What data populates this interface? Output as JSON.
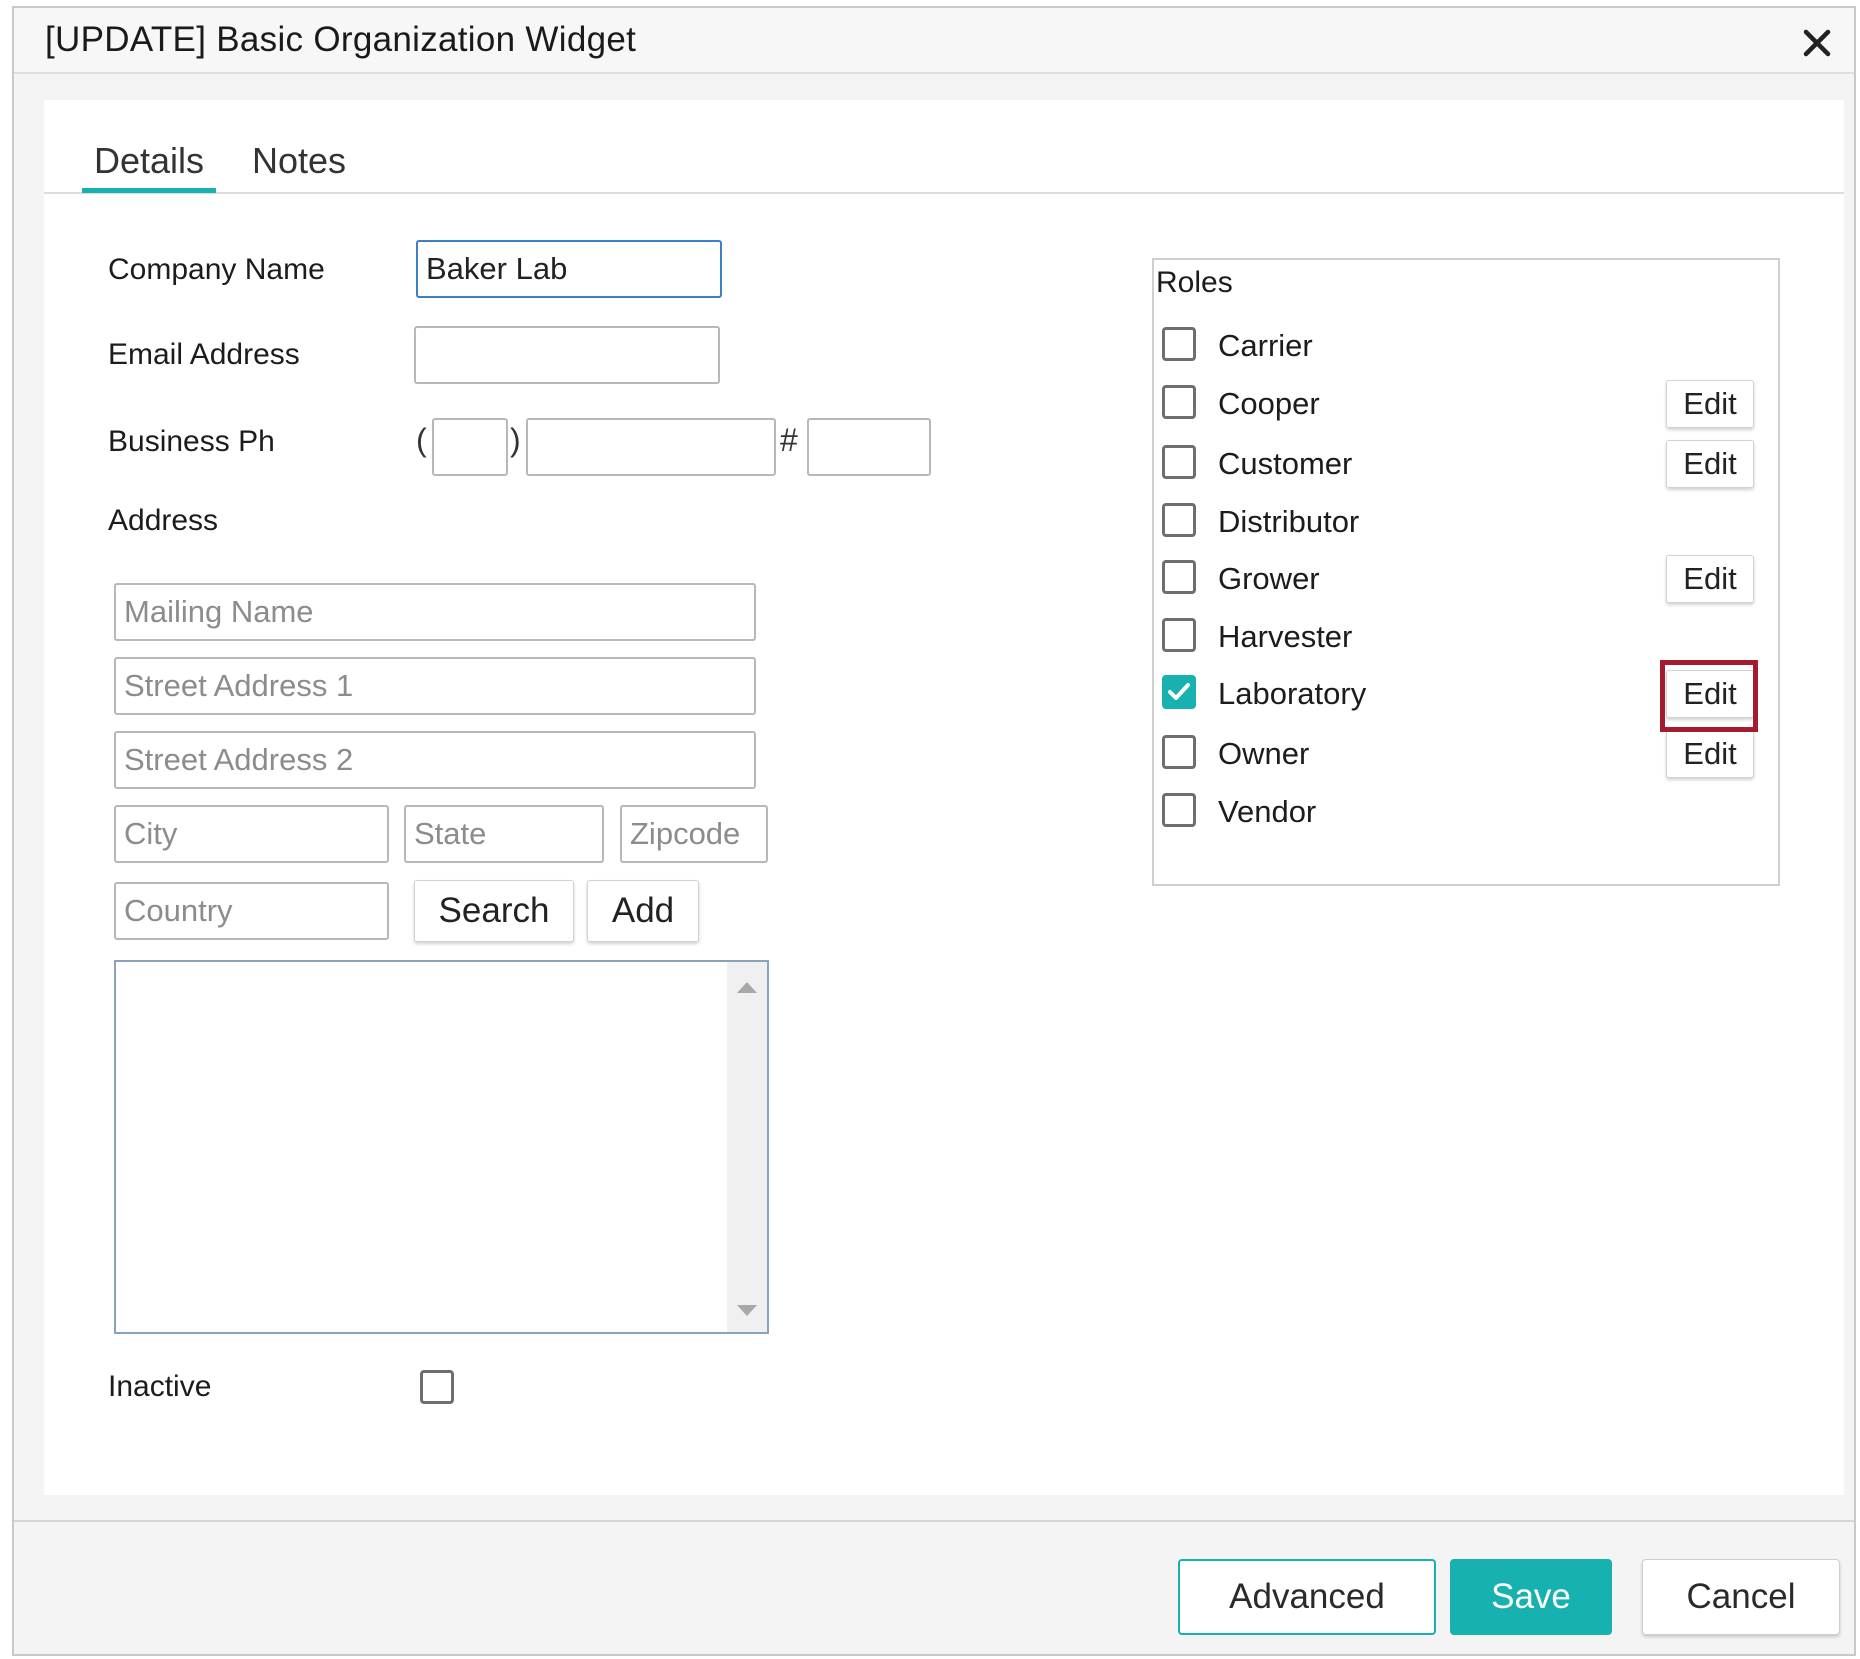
{
  "dialog": {
    "title": "[UPDATE] Basic Organization Widget",
    "close_icon": "close-icon"
  },
  "tabs": [
    {
      "label": "Details",
      "active": true
    },
    {
      "label": "Notes",
      "active": false
    }
  ],
  "form": {
    "company_name": {
      "label": "Company Name",
      "value": "Baker Lab"
    },
    "email": {
      "label": "Email Address",
      "value": ""
    },
    "business_phone": {
      "label": "Business Ph",
      "open_paren": "(",
      "close_paren": ")",
      "hash": "#"
    },
    "address": {
      "label": "Address",
      "mailing_name_placeholder": "Mailing Name",
      "street1_placeholder": "Street Address 1",
      "street2_placeholder": "Street Address 2",
      "city_placeholder": "City",
      "state_placeholder": "State",
      "zip_placeholder": "Zipcode",
      "country_placeholder": "Country",
      "search_label": "Search",
      "add_label": "Add"
    },
    "inactive": {
      "label": "Inactive",
      "checked": false
    }
  },
  "roles": {
    "title": "Roles",
    "edit_label": "Edit",
    "items": [
      {
        "label": "Carrier",
        "checked": false,
        "editable": false
      },
      {
        "label": "Cooper",
        "checked": false,
        "editable": true
      },
      {
        "label": "Customer",
        "checked": false,
        "editable": true
      },
      {
        "label": "Distributor",
        "checked": false,
        "editable": false
      },
      {
        "label": "Grower",
        "checked": false,
        "editable": true
      },
      {
        "label": "Harvester",
        "checked": false,
        "editable": false
      },
      {
        "label": "Laboratory",
        "checked": true,
        "editable": true
      },
      {
        "label": "Owner",
        "checked": false,
        "editable": true
      },
      {
        "label": "Vendor",
        "checked": false,
        "editable": false
      }
    ]
  },
  "footer": {
    "advanced_label": "Advanced",
    "save_label": "Save",
    "cancel_label": "Cancel"
  },
  "colors": {
    "accent": "#17b2b0",
    "highlight": "#a31c2e",
    "focus_border": "#3d7fc4"
  }
}
